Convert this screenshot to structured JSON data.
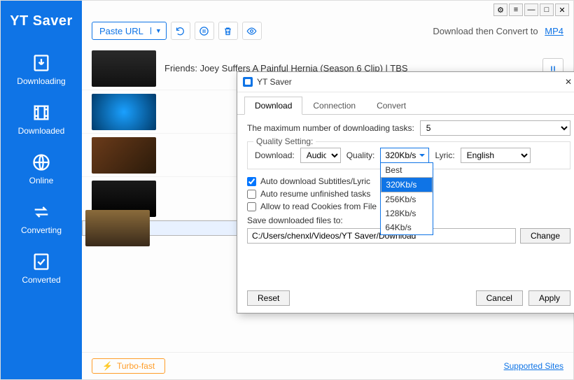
{
  "app_name": "YT Saver",
  "toolbar": {
    "paste_label": "Paste URL",
    "convert_prefix": "Download then Convert to",
    "convert_format": "MP4"
  },
  "sidebar": {
    "items": [
      {
        "label": "Downloading"
      },
      {
        "label": "Downloaded"
      },
      {
        "label": "Online"
      },
      {
        "label": "Converting"
      },
      {
        "label": "Converted"
      }
    ]
  },
  "rows": [
    {
      "title": "Friends: Joey Suffers A Painful Hernia (Season 6 Clip) | TBS",
      "action": "pause"
    },
    {
      "title": "",
      "action": "play"
    },
    {
      "title": "",
      "action": "play"
    },
    {
      "title": "",
      "action": "play"
    },
    {
      "title": "",
      "action": "play"
    }
  ],
  "footer": {
    "turbo_label": "Turbo-fast",
    "supported_label": "Supported Sites"
  },
  "dialog": {
    "title": "YT Saver",
    "tabs": {
      "download": "Download",
      "connection": "Connection",
      "convert": "Convert"
    },
    "max_tasks_label": "The maximum number of downloading tasks:",
    "max_tasks_value": "5",
    "quality_legend": "Quality Setting:",
    "download_label": "Download:",
    "download_value": "Audio",
    "quality_label": "Quality:",
    "quality_value": "320Kb/s",
    "quality_options": [
      "Best",
      "320Kb/s",
      "256Kb/s",
      "128Kb/s",
      "64Kb/s"
    ],
    "quality_selected_index": 1,
    "lyric_label": "Lyric:",
    "lyric_value": "English",
    "chk_subtitles": "Auto download Subtitles/Lyric",
    "chk_resume": "Auto resume unfinished tasks",
    "chk_cookies": "Allow to read Cookies from File",
    "save_label": "Save downloaded files to:",
    "save_path": "C:/Users/chenxl/Videos/YT Saver/Download",
    "change_label": "Change",
    "reset_label": "Reset",
    "cancel_label": "Cancel",
    "apply_label": "Apply"
  }
}
